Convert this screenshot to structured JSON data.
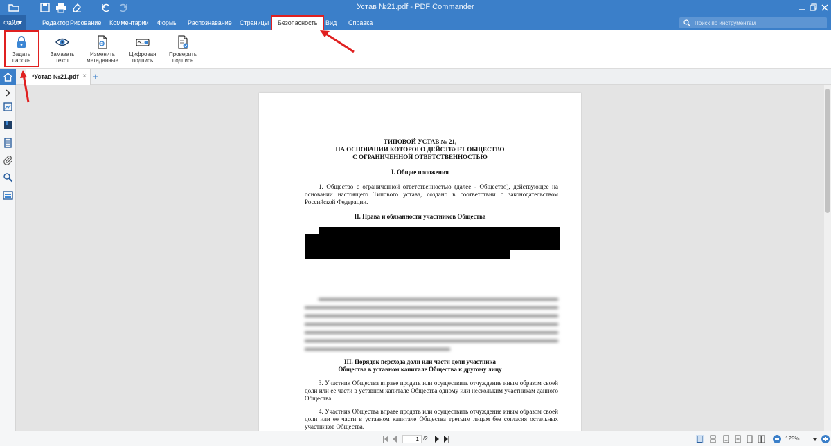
{
  "window": {
    "title": "Устав №21.pdf - PDF Commander"
  },
  "quick_access": {
    "icons": [
      "open-folder-icon",
      "save-icon",
      "print-icon",
      "clear-icon",
      "undo-icon",
      "redo-icon"
    ]
  },
  "menu": {
    "file_label": "Файл",
    "items": [
      {
        "id": "editor",
        "label": "Редактор"
      },
      {
        "id": "drawing",
        "label": "Рисование"
      },
      {
        "id": "comments",
        "label": "Комментарии"
      },
      {
        "id": "forms",
        "label": "Формы"
      },
      {
        "id": "recognition",
        "label": "Распознавание"
      },
      {
        "id": "pages",
        "label": "Страницы"
      },
      {
        "id": "security",
        "label": "Безопасность",
        "active": true
      },
      {
        "id": "view",
        "label": "Вид"
      },
      {
        "id": "help",
        "label": "Справка"
      }
    ],
    "search_placeholder": "Поиск по инструментам"
  },
  "ribbon": {
    "buttons": [
      {
        "id": "set-password",
        "label": "Задать пароль",
        "icon": "lock-icon",
        "highlighted": true
      },
      {
        "id": "redact-text",
        "label": "Замазать текст",
        "icon": "eye-icon"
      },
      {
        "id": "edit-metadata",
        "label": "Изменить метаданные",
        "icon": "metadata-icon"
      },
      {
        "id": "digital-signature",
        "label": "Цифровая подпись",
        "icon": "signature-icon"
      },
      {
        "id": "verify-signature",
        "label": "Проверить подпись",
        "icon": "verify-document-icon"
      }
    ]
  },
  "tabs": {
    "open": [
      {
        "label": "*Устав №21.pdf",
        "close": "×"
      }
    ],
    "new_tab": "+"
  },
  "document": {
    "heading": [
      "ТИПОВОЙ УСТАВ № 21,",
      "НА ОСНОВАНИИ КОТОРОГО ДЕЙСТВУЕТ ОБЩЕСТВО",
      "С ОГРАНИЧЕННОЙ ОТВЕТСТВЕННОСТЬЮ"
    ],
    "section1_title": "I. Общие положения",
    "para1": "1. Общество с ограниченной ответственностью (далее - Общество), действующее на основании настоящего Типового устава, создано в соответствии с законодательством Российской Федерации.",
    "section2_title": "II. Права и обязанности участников Общества",
    "section3_title_line1": "III. Порядок перехода доли или части доли участника",
    "section3_title_line2": "Общества в уставном капитале Общества к другому лицу",
    "para3": "3. Участник Общества вправе продать или осуществить отчуждение иным образом своей доли или ее части в уставном капитале Общества одному или нескольким участникам данного Общества.",
    "para4": "4. Участник Общества вправе продать или осуществить отчуждение иным образом своей доли или ее части в уставном капитале Общества третьим лицам без согласия остальных участников Общества."
  },
  "status": {
    "current_page": "1",
    "total_pages": "/2",
    "zoom": "125%"
  },
  "colors": {
    "accent": "#3b7fc9",
    "highlight": "#e02020"
  }
}
